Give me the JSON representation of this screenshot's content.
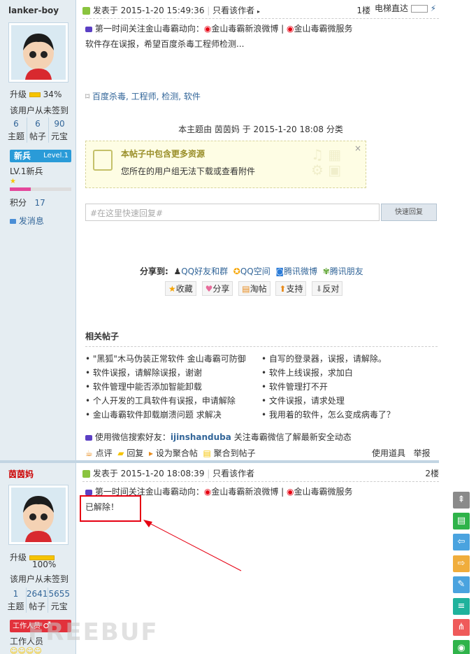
{
  "post1": {
    "username": "lanker-boy",
    "upgrade_label": "升级",
    "upgrade_pct": "34%",
    "upgrade_fraction": 0.34,
    "signin": "该用户从未签到",
    "stats": [
      {
        "n": "6",
        "l": "主题"
      },
      {
        "n": "6",
        "l": "帖子"
      },
      {
        "n": "90",
        "l": "元宝"
      }
    ],
    "rank_badge": "新兵",
    "level_badge": "Level.1",
    "rank_text": "LV.1新兵",
    "points_label": "积分",
    "points": "17",
    "msg_label": "发消息",
    "posted": "发表于 2015-1-20 15:49:36",
    "only_author": "只看该作者",
    "floor": "1楼",
    "elevator": "电梯直达",
    "promo_prefix": "第一时间关注金山毒霸动向：",
    "promo_weibo": "金山毒霸新浪微博",
    "promo_sep": "|",
    "promo_micro": "金山毒霸微服务",
    "body": "软件存在误报，希望百度杀毒工程师检测...",
    "tags_label": "百度杀毒, 工程师, 检测, 软件",
    "category_note": "本主题由 茵茵妈 于 2015-1-20 18:08 分类",
    "attach_title": "本帖子中包含更多资源",
    "attach_text": "您所在的用户组无法下载或查看附件",
    "quick_reply_placeholder": "#在这里快速回复#",
    "quick_reply_btn": "快速回复",
    "share_label": "分享到:",
    "share": [
      "QQ好友和群",
      "QQ空间",
      "腾讯微博",
      "腾讯朋友"
    ],
    "actions": [
      "收藏",
      "分享",
      "淘帖",
      "支持",
      "反对"
    ],
    "related_title": "相关帖子",
    "related_left": [
      "\"黑狐\"木马伪装正常软件 金山毒霸可防御",
      "软件误报，请解除误报，谢谢",
      "软件管理中能否添加智能卸载",
      "个人开发的工具软件有误报，申请解除",
      "金山毒霸软件卸载崩溃问题 求解决"
    ],
    "related_right": [
      "自写的登录器，误报，请解除。",
      "软件上线误报，求加白",
      "软件管理打不开",
      "文件误报，请求处理",
      "我用着的软件，怎么变成病毒了？"
    ],
    "wechat_prefix": "使用微信搜索好友：",
    "wechat_id": "ijinshanduba",
    "wechat_suffix": " 关注毒霸微信了解最新安全动态",
    "footer_left": [
      "点评",
      "回复",
      "设为聚合帖",
      "聚合到帖子"
    ],
    "footer_right": [
      "使用道具",
      "举报"
    ]
  },
  "post2": {
    "username": "茵茵妈",
    "upgrade_label": "升级",
    "upgrade_pct": "100%",
    "upgrade_fraction": 1.0,
    "signin": "该用户从未签到",
    "stats": [
      {
        "n": "1",
        "l": "主题"
      },
      {
        "n": "2641",
        "l": "帖子"
      },
      {
        "n": "5655",
        "l": "元宝"
      }
    ],
    "staff_badge": "工作人员",
    "staff_text": "工作人员",
    "posted": "发表于 2015-1-20 18:08:39",
    "only_author": "只看该作者",
    "floor": "2楼",
    "promo_prefix": "第一时间关注金山毒霸动向：",
    "promo_weibo": "金山毒霸新浪微博",
    "promo_sep": "|",
    "promo_micro": "金山毒霸微服务",
    "body": "已解除！"
  },
  "watermark": "FREEBUF",
  "colors": {
    "annotation_red": "#e60012",
    "link": "#336699",
    "sidebar_bg": "#e5edf2"
  },
  "side_buttons": [
    {
      "icon": "top-icon",
      "glyph": "⌅",
      "color": "#8a8a8a"
    },
    {
      "icon": "post-icon",
      "glyph": "▤",
      "color": "#2fb34a"
    },
    {
      "icon": "prev-icon",
      "glyph": "⇦",
      "color": "#4aa3df"
    },
    {
      "icon": "next-icon",
      "glyph": "⇨",
      "color": "#f0ad3c"
    },
    {
      "icon": "edit-icon",
      "glyph": "✎",
      "color": "#4aa3df"
    },
    {
      "icon": "list-icon",
      "glyph": "≡",
      "color": "#1fb29c"
    },
    {
      "icon": "share-icon",
      "glyph": "⋔",
      "color": "#ef5a5a"
    },
    {
      "icon": "wechat-icon",
      "glyph": "◉",
      "color": "#2fb34a"
    }
  ]
}
